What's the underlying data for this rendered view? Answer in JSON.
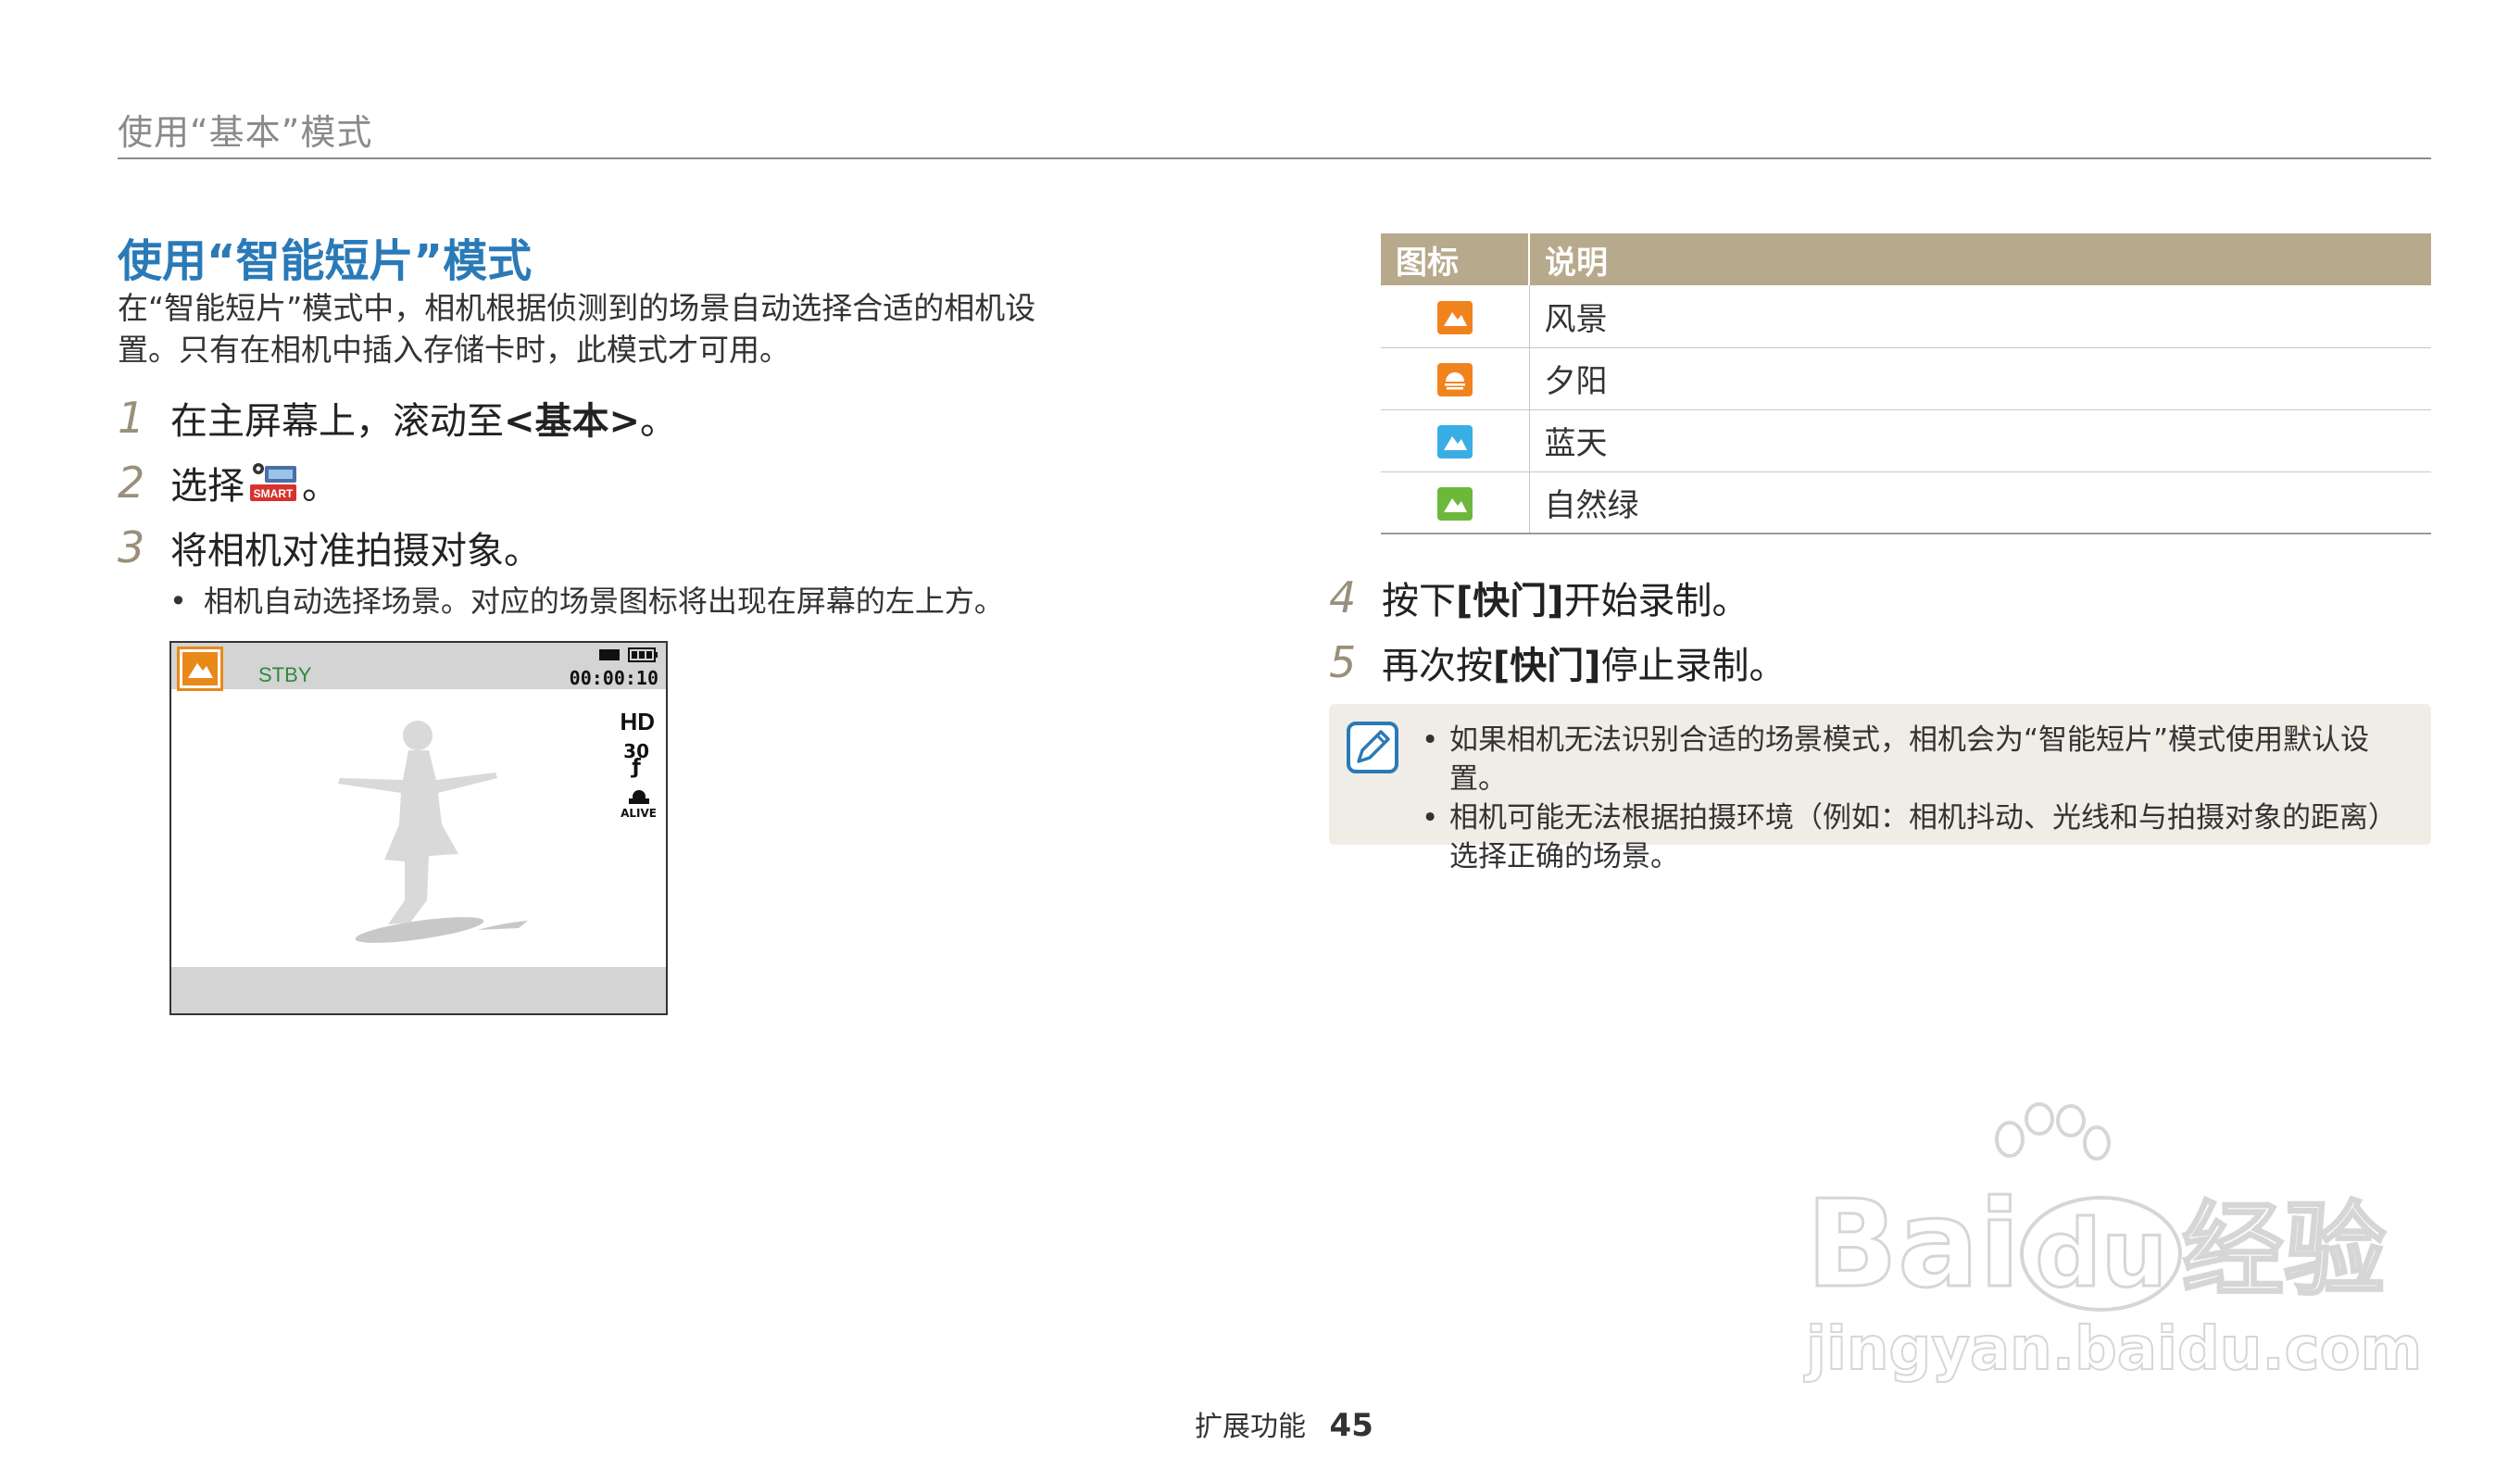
{
  "header": {
    "title": "使用“基本”模式"
  },
  "section": {
    "title": "使用“智能短片”模式",
    "intro_line1": "在“智能短片”模式中，相机根据侦测到的场景自动选择合适的相机设",
    "intro_line2": "置。只有在相机中插入存储卡时，此模式才可用。"
  },
  "steps": [
    {
      "num": "1",
      "pre": "在主屏幕上，滚动至 ",
      "bold": "<基本>",
      "post": "。"
    },
    {
      "num": "2",
      "pre": "选择 ",
      "icon_label": "SMART",
      "post": "。"
    },
    {
      "num": "3",
      "text": "将相机对准拍摄对象。"
    }
  ],
  "step3_bullet": "相机自动选择场景。对应的场景图标将出现在屏幕的左上方。",
  "camera_screen": {
    "status": "STBY",
    "timer": "00:00:10",
    "quality": "HD",
    "fps": "30",
    "alive_label": "ALIVE",
    "scene_icon": "landscape-icon"
  },
  "table": {
    "headers": [
      "图标",
      "说明"
    ],
    "rows": [
      {
        "icon": "landscape-icon",
        "color": "#f0831e",
        "label": "风景"
      },
      {
        "icon": "sunset-icon",
        "color": "#f0831e",
        "label": "夕阳"
      },
      {
        "icon": "blue-sky-icon",
        "color": "#39aee5",
        "label": "蓝天"
      },
      {
        "icon": "natural-green-icon",
        "color": "#6cb83a",
        "label": "自然绿"
      }
    ]
  },
  "right_steps": [
    {
      "num": "4",
      "pre": "按下 ",
      "bold": "[快门]",
      "post": " 开始录制。"
    },
    {
      "num": "5",
      "pre": "再次按 ",
      "bold": "[快门]",
      "post": " 停止录制。"
    }
  ],
  "note": {
    "icon": "note-pencil-icon",
    "items": [
      "如果相机无法识别合适的场景模式，相机会为“智能短片”模式使用默认设置。",
      "相机可能无法根据拍摄环境（例如：相机抖动、光线和与拍摄对象的距离）选择正确的场景。"
    ]
  },
  "footer": {
    "section": "扩展功能",
    "page": "45"
  },
  "watermark": {
    "brand": "Bai",
    "brand_du": "du",
    "cn": "经验",
    "url": "jingyan.baidu.com"
  },
  "colors": {
    "accent_blue": "#2a7ab8",
    "table_header": "#b7a98b",
    "step_num": "#9a8f7a",
    "note_bg": "#f0ede6"
  }
}
